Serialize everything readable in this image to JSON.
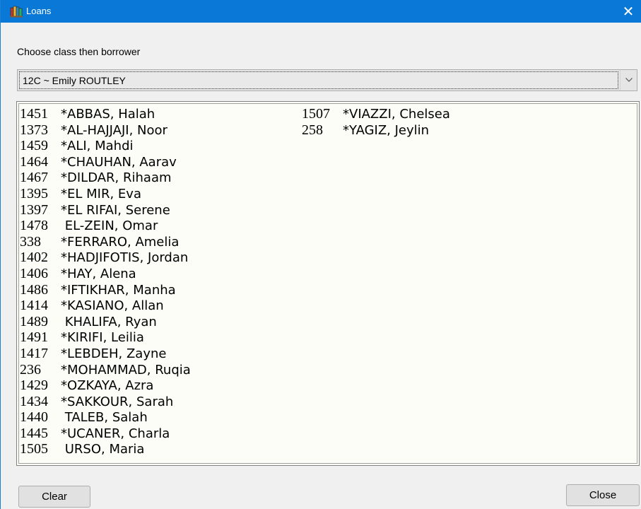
{
  "window": {
    "title": "Loans",
    "close_glyph": "✕",
    "icon": "books-app-icon",
    "colors": {
      "titlebar": "#0a78d7",
      "background": "#f0f0f0",
      "list_background": "#fcfdf6"
    }
  },
  "instruction": "Choose class then borrower",
  "class_select": {
    "selected": "12C ~ Emily ROUTLEY"
  },
  "borrowers": {
    "column_1": [
      {
        "id": "1451",
        "name": "*ABBAS, Halah"
      },
      {
        "id": "1373",
        "name": "*AL-HAJJAJI, Noor"
      },
      {
        "id": "1459",
        "name": "*ALI, Mahdi"
      },
      {
        "id": "1464",
        "name": "*CHAUHAN, Aarav"
      },
      {
        "id": "1467",
        "name": "*DILDAR, Rihaam"
      },
      {
        "id": "1395",
        "name": "*EL MIR, Eva"
      },
      {
        "id": "1397",
        "name": "*EL RIFAI, Serene"
      },
      {
        "id": "1478",
        "name": " EL-ZEIN, Omar"
      },
      {
        "id": "338",
        "name": "*FERRARO, Amelia"
      },
      {
        "id": "1402",
        "name": "*HADJIFOTIS, Jordan"
      },
      {
        "id": "1406",
        "name": "*HAY, Alena"
      },
      {
        "id": "1486",
        "name": "*IFTIKHAR, Manha"
      },
      {
        "id": "1414",
        "name": "*KASIANO, Allan"
      },
      {
        "id": "1489",
        "name": " KHALIFA, Ryan"
      },
      {
        "id": "1491",
        "name": "*KIRIFI, Leilia"
      },
      {
        "id": "1417",
        "name": "*LEBDEH, Zayne"
      },
      {
        "id": "236",
        "name": "*MOHAMMAD, Ruqia"
      },
      {
        "id": "1429",
        "name": "*OZKAYA, Azra"
      },
      {
        "id": "1434",
        "name": "*SAKKOUR, Sarah"
      },
      {
        "id": "1440",
        "name": " TALEB, Salah"
      },
      {
        "id": "1445",
        "name": "*UCANER, Charla"
      },
      {
        "id": "1505",
        "name": " URSO, Maria"
      }
    ],
    "column_2": [
      {
        "id": "1507",
        "name": "*VIAZZI, Chelsea"
      },
      {
        "id": "258",
        "name": "*YAGIZ, Jeylin"
      }
    ]
  },
  "buttons": {
    "clear": "Clear",
    "close": "Close"
  }
}
